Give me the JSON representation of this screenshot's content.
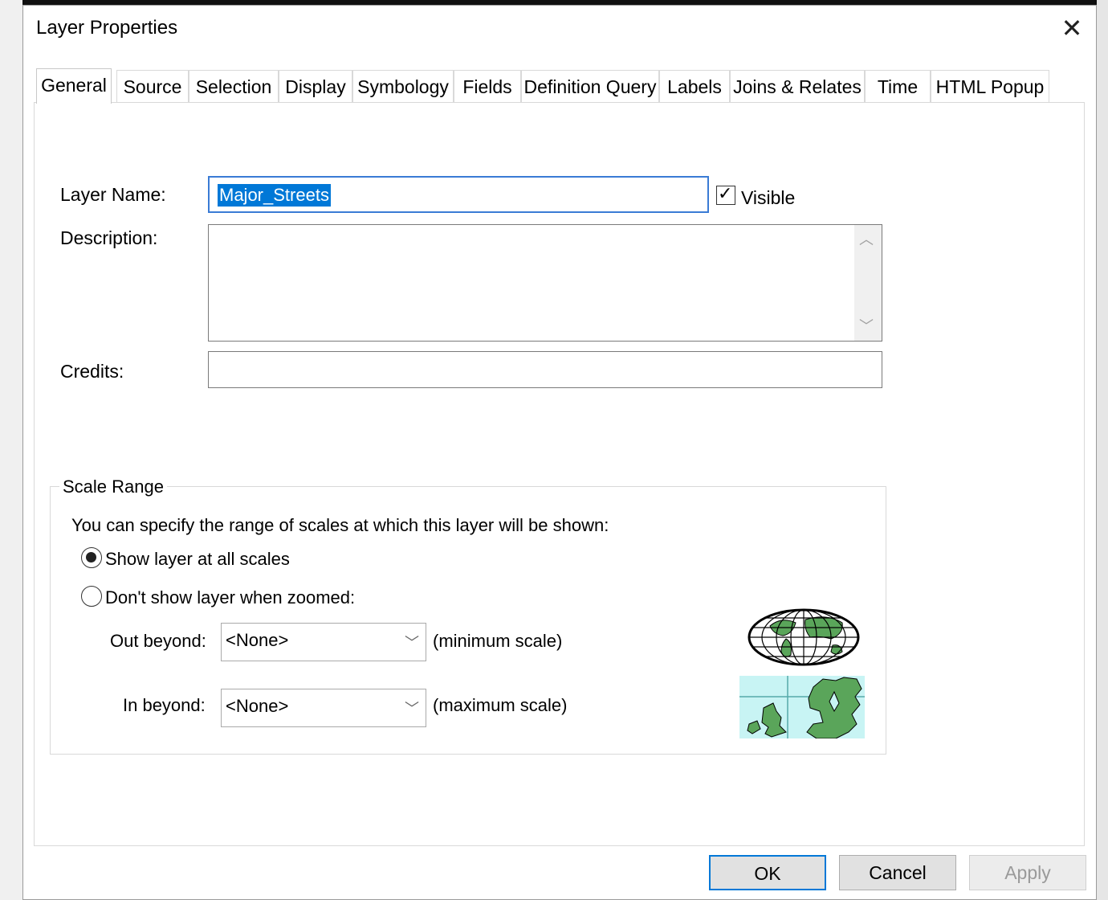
{
  "dialog": {
    "title": "Layer Properties",
    "close_icon": "close-icon"
  },
  "tabs": [
    "General",
    "Source",
    "Selection",
    "Display",
    "Symbology",
    "Fields",
    "Definition Query",
    "Labels",
    "Joins & Relates",
    "Time",
    "HTML Popup"
  ],
  "active_tab": "General",
  "general": {
    "layer_name_label": "Layer Name:",
    "layer_name_value": "Major_Streets",
    "visible_label": "Visible",
    "visible_checked": true,
    "description_label": "Description:",
    "description_value": "",
    "credits_label": "Credits:",
    "credits_value": ""
  },
  "scale_range": {
    "title": "Scale Range",
    "intro": "You can specify the range of scales at which this layer will be shown:",
    "option_all": "Show layer at all scales",
    "option_zoomed": "Don't show layer when zoomed:",
    "selected_option": "all",
    "out_label": "Out beyond:",
    "out_value": "<None>",
    "out_hint": "(minimum scale)",
    "in_label": "In beyond:",
    "in_value": "<None>",
    "in_hint": "(maximum scale)"
  },
  "buttons": {
    "ok": "OK",
    "cancel": "Cancel",
    "apply": "Apply"
  },
  "colors": {
    "accent": "#0078d7",
    "map_land": "#5aa55a",
    "map_sea": "#c8f4f4"
  },
  "icons": [
    "world-globe-icon",
    "regional-map-icon",
    "check-icon",
    "chevron-down-icon",
    "chevron-up-icon"
  ]
}
